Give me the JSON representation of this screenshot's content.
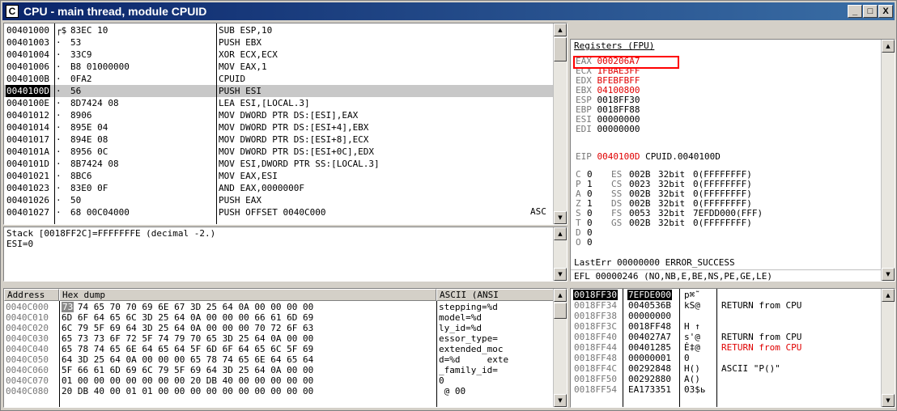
{
  "window": {
    "icon_letter": "C",
    "title": "CPU - main thread, module CPUID",
    "minimize": "_",
    "maximize": "□",
    "close": "X"
  },
  "disasm": {
    "rows": [
      {
        "addr": "00401000",
        "mark": "┌$",
        "hex": "83EC 10",
        "instr": "SUB ESP,10",
        "selected": false
      },
      {
        "addr": "00401003",
        "mark": "·",
        "hex": "53",
        "instr": "PUSH EBX",
        "selected": false
      },
      {
        "addr": "00401004",
        "mark": "·",
        "hex": "33C9",
        "instr": "XOR ECX,ECX",
        "selected": false
      },
      {
        "addr": "00401006",
        "mark": "·",
        "hex": "B8 01000000",
        "instr": "MOV EAX,1",
        "selected": false
      },
      {
        "addr": "0040100B",
        "mark": "·",
        "hex": "0FA2",
        "instr": "CPUID",
        "selected": false
      },
      {
        "addr": "0040100D",
        "mark": "·",
        "hex": "56",
        "instr": "PUSH ESI",
        "selected": true
      },
      {
        "addr": "0040100E",
        "mark": "·",
        "hex": "8D7424 08",
        "instr": "LEA ESI,[LOCAL.3]",
        "selected": false
      },
      {
        "addr": "00401012",
        "mark": "·",
        "hex": "8906",
        "instr": "MOV DWORD PTR DS:[ESI],EAX",
        "selected": false
      },
      {
        "addr": "00401014",
        "mark": "·",
        "hex": "895E 04",
        "instr": "MOV DWORD PTR DS:[ESI+4],EBX",
        "selected": false
      },
      {
        "addr": "00401017",
        "mark": "·",
        "hex": "894E 08",
        "instr": "MOV DWORD PTR DS:[ESI+8],ECX",
        "selected": false
      },
      {
        "addr": "0040101A",
        "mark": "·",
        "hex": "8956 0C",
        "instr": "MOV DWORD PTR DS:[ESI+0C],EDX",
        "selected": false
      },
      {
        "addr": "0040101D",
        "mark": "·",
        "hex": "8B7424 08",
        "instr": "MOV ESI,DWORD PTR SS:[LOCAL.3]",
        "selected": false
      },
      {
        "addr": "00401021",
        "mark": "·",
        "hex": "8BC6",
        "instr": "MOV EAX,ESI",
        "selected": false
      },
      {
        "addr": "00401023",
        "mark": "·",
        "hex": "83E0 0F",
        "instr": "AND EAX,0000000F",
        "selected": false
      },
      {
        "addr": "00401026",
        "mark": "·",
        "hex": "50",
        "instr": "PUSH EAX",
        "selected": false
      },
      {
        "addr": "00401027",
        "mark": "·",
        "hex": "68 00C04000",
        "instr": "PUSH OFFSET 0040C000",
        "selected": false
      }
    ],
    "comment": "ASC"
  },
  "info": {
    "line1": "Stack [0018FF2C]=FFFFFFFE (decimal -2.)",
    "line2": "ESI=0"
  },
  "registers": {
    "header": "Registers (FPU)",
    "gpr": [
      {
        "name": "EAX",
        "value": "000206A7",
        "changed": true,
        "note": ""
      },
      {
        "name": "ECX",
        "value": "1FBAE3FF",
        "changed": true,
        "note": ""
      },
      {
        "name": "EDX",
        "value": "BFEBFBFF",
        "changed": true,
        "note": ""
      },
      {
        "name": "EBX",
        "value": "04100800",
        "changed": true,
        "note": ""
      },
      {
        "name": "ESP",
        "value": "0018FF30",
        "changed": false,
        "note": ""
      },
      {
        "name": "EBP",
        "value": "0018FF88",
        "changed": false,
        "note": ""
      },
      {
        "name": "ESI",
        "value": "00000000",
        "changed": false,
        "note": ""
      },
      {
        "name": "EDI",
        "value": "00000000",
        "changed": false,
        "note": ""
      }
    ],
    "eip": {
      "name": "EIP",
      "value": "0040100D",
      "note": "CPUID.0040100D"
    },
    "flags": [
      {
        "f": "C",
        "v": "0",
        "seg": "ES",
        "sel": "002B",
        "bits": "32bit",
        "base": "0(FFFFFFFF)"
      },
      {
        "f": "P",
        "v": "1",
        "seg": "CS",
        "sel": "0023",
        "bits": "32bit",
        "base": "0(FFFFFFFF)"
      },
      {
        "f": "A",
        "v": "0",
        "seg": "SS",
        "sel": "002B",
        "bits": "32bit",
        "base": "0(FFFFFFFF)"
      },
      {
        "f": "Z",
        "v": "1",
        "seg": "DS",
        "sel": "002B",
        "bits": "32bit",
        "base": "0(FFFFFFFF)"
      },
      {
        "f": "S",
        "v": "0",
        "seg": "FS",
        "sel": "0053",
        "bits": "32bit",
        "base": "7EFDD000(FFF)"
      },
      {
        "f": "T",
        "v": "0",
        "seg": "GS",
        "sel": "002B",
        "bits": "32bit",
        "base": "0(FFFFFFFF)"
      },
      {
        "f": "D",
        "v": "0",
        "seg": "",
        "sel": "",
        "bits": "",
        "base": ""
      },
      {
        "f": "O",
        "v": "0",
        "seg": "",
        "sel": "",
        "bits": "",
        "base": ""
      }
    ],
    "lasterr": "LastErr 00000000 ERROR_SUCCESS",
    "efl": "EFL 00000246 (NO,NB,E,BE,NS,PE,GE,LE)"
  },
  "dump": {
    "col_address": "Address",
    "col_hex": "Hex dump",
    "col_ascii": "ASCII (ANSI",
    "rows": [
      {
        "addr": "0040C000",
        "hex": "73 74 65 70 70 69 6E 67 3D 25 64 0A 00 00 00 00",
        "ascii": "stepping=%d"
      },
      {
        "addr": "0040C010",
        "hex": "6D 6F 64 65 6C 3D 25 64 0A 00 00 00 66 61 6D 69",
        "ascii": "model=%d"
      },
      {
        "addr": "0040C020",
        "hex": "6C 79 5F 69 64 3D 25 64 0A 00 00 00 70 72 6F 63",
        "ascii": "ly_id=%d"
      },
      {
        "addr": "0040C030",
        "hex": "65 73 73 6F 72 5F 74 79 70 65 3D 25 64 0A 00 00",
        "ascii": "essor_type="
      },
      {
        "addr": "0040C040",
        "hex": "65 78 74 65 6E 64 65 64 5F 6D 6F 64 65 6C 5F 69",
        "ascii": "extended_moc"
      },
      {
        "addr": "0040C050",
        "hex": "64 3D 25 64 0A 00 00 00 65 78 74 65 6E 64 65 64",
        "ascii": "d=%d     exte"
      },
      {
        "addr": "0040C060",
        "hex": "5F 66 61 6D 69 6C 79 5F 69 64 3D 25 64 0A 00 00",
        "ascii": "_family_id="
      },
      {
        "addr": "0040C070",
        "hex": "01 00 00 00 00 00 00 00 20 DB 40 00 00 00 00 00",
        "ascii": "0"
      },
      {
        "addr": "0040C080",
        "hex": "20 DB 40 00 01 01 00 00 00 00 00 00 00 00 00 00",
        "ascii": " @ 00"
      }
    ],
    "first_byte": "73"
  },
  "stack": {
    "rows": [
      {
        "addr": "0018FF30",
        "val": "7EFDE000",
        "com": "p⌘˜",
        "selected": true
      },
      {
        "addr": "0018FF34",
        "val": "0040536B",
        "com": "kS@",
        "note": "RETURN from CPU",
        "red": false
      },
      {
        "addr": "0018FF38",
        "val": "00000000",
        "com": "",
        "note": "",
        "red": false
      },
      {
        "addr": "0018FF3C",
        "val": "0018FF48",
        "com": "H ↑",
        "note": "",
        "red": false
      },
      {
        "addr": "0018FF40",
        "val": "004027A7",
        "com": "s'@",
        "note": "RETURN from CPU",
        "red": false
      },
      {
        "addr": "0018FF44",
        "val": "00401285",
        "com": "Ė‡@",
        "note": "RETURN from CPU",
        "red": true
      },
      {
        "addr": "0018FF48",
        "val": "00000001",
        "com": "0",
        "note": "",
        "red": false
      },
      {
        "addr": "0018FF4C",
        "val": "00292848",
        "com": "H()",
        "note": "ASCII \"P()\"",
        "red": false
      },
      {
        "addr": "0018FF50",
        "val": "00292880",
        "com": "A()",
        "note": "",
        "red": false
      },
      {
        "addr": "0018FF54",
        "val": "EA173351",
        "com": "03$ь",
        "note": "",
        "red": false
      }
    ]
  },
  "colors": {
    "title_start": "#0a246a",
    "title_end": "#3a6ea5",
    "changed_reg": "#e00000",
    "highlight_box": "#ff0000"
  }
}
